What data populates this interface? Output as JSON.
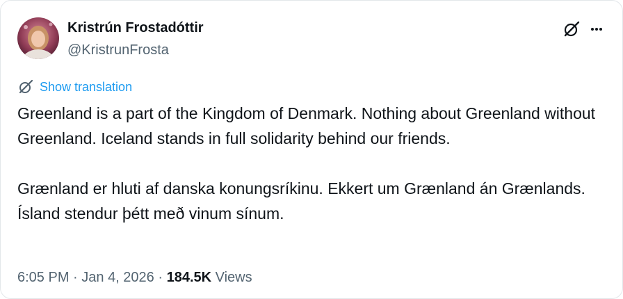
{
  "author": {
    "display_name": "Kristrún Frostadóttir",
    "handle": "@KristrunFrosta"
  },
  "header_actions": {
    "grok_icon": "grok-icon",
    "more_icon": "more-horizontal-icon"
  },
  "translation": {
    "icon": "translate-icon",
    "label": "Show translation"
  },
  "tweet": {
    "paragraph_1": "Greenland is a part of the Kingdom of Denmark. Nothing about Greenland without Greenland. Iceland stands in full solidarity behind our friends.",
    "paragraph_2": "Grænland er hluti af danska konungsríkinu. Ekkert um Grænland án Grænlands. Ísland stendur þétt með vinum sínum."
  },
  "meta": {
    "time": "6:05 PM",
    "separator": " · ",
    "date": "Jan 4, 2026",
    "views_count": "184.5K",
    "views_label": " Views"
  },
  "colors": {
    "text": "#0f1419",
    "secondary": "#536471",
    "link": "#1d9bf0",
    "border": "#e3e7ea"
  }
}
